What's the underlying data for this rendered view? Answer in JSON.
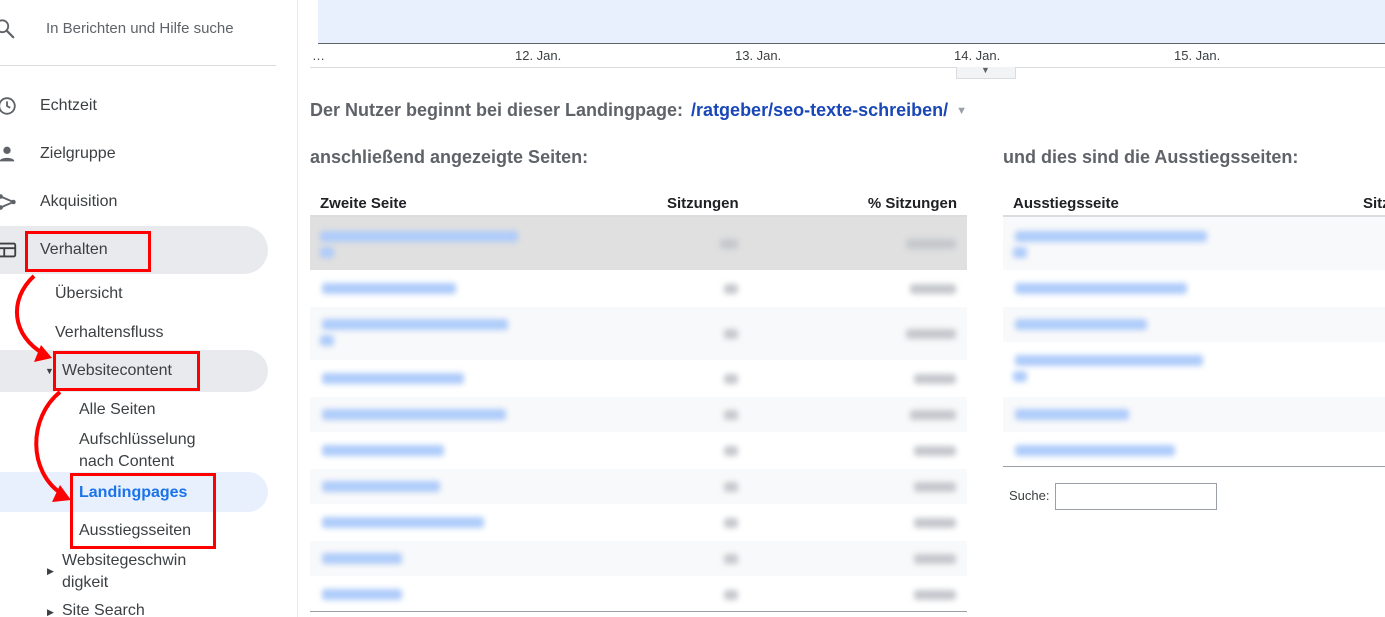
{
  "sidebar": {
    "search_placeholder": "In Berichten und Hilfe suche",
    "items": [
      {
        "label": "Echtzeit",
        "icon": "clock-icon"
      },
      {
        "label": "Zielgruppe",
        "icon": "person-icon"
      },
      {
        "label": "Akquisition",
        "icon": "acquisition-icon"
      },
      {
        "label": "Verhalten",
        "icon": "behavior-icon"
      }
    ],
    "verhalten_children": {
      "uebersicht": "Übersicht",
      "verhaltensfluss": "Verhaltensfluss",
      "websitecontent": "Websitecontent"
    },
    "websitecontent_children": {
      "alle_seiten": "Alle Seiten",
      "aufschluesselung_1": "Aufschlüsselung",
      "aufschluesselung_2": "nach Content",
      "landingpages": "Landingpages",
      "ausstiegsseiten": "Ausstiegsseiten"
    },
    "more": {
      "geschwindigkeit_1": "Websitegeschwin",
      "geschwindigkeit_2": "digkeit",
      "site_search": "Site Search"
    }
  },
  "chart": {
    "x_ticks": [
      "…",
      "12. Jan.",
      "13. Jan.",
      "14. Jan.",
      "15. Jan."
    ]
  },
  "landing": {
    "prefix": "Der Nutzer beginnt bei dieser Landingpage:",
    "path": "/ratgeber/seo-texte-schreiben/"
  },
  "next_pages": {
    "title": "anschließend angezeigte Seiten:",
    "columns": [
      "Zweite Seite",
      "Sitzungen",
      "% Sitzungen"
    ]
  },
  "exit_pages": {
    "title": "und dies sind die Ausstiegsseiten:",
    "columns": [
      "Ausstiegsseite",
      "Sitz"
    ]
  },
  "search": {
    "label": "Suche:",
    "value": ""
  },
  "colors": {
    "accent": "#1a73e8",
    "annotation": "#ff0000",
    "link": "#1a47b8"
  }
}
